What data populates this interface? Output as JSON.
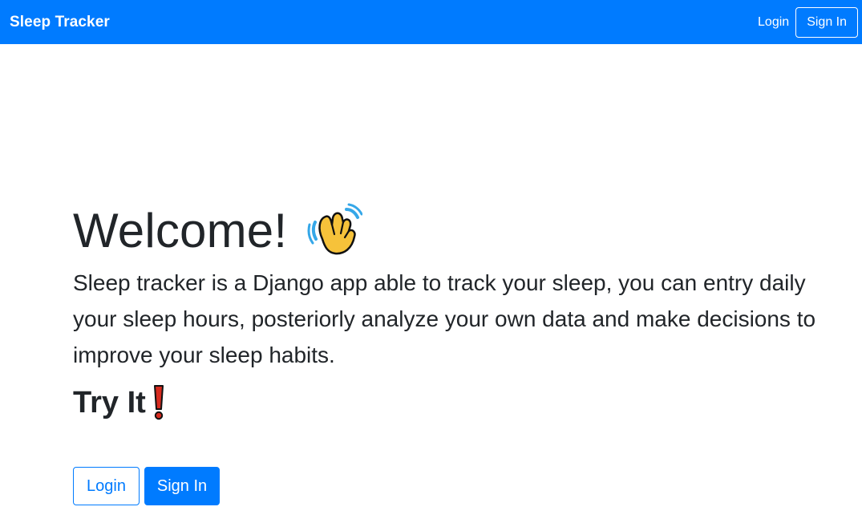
{
  "navbar": {
    "brand": "Sleep Tracker",
    "login_label": "Login",
    "signin_label": "Sign In"
  },
  "hero": {
    "title": "Welcome!",
    "title_icon": "waving-hand-icon",
    "description": "Sleep tracker is a Django app able to track your sleep, you can entry daily your sleep hours, posteriorly analyze your own data and make decisions to improve your sleep habits.",
    "subtitle": "Try It",
    "subtitle_icon": "exclamation-mark-icon"
  },
  "actions": {
    "login_label": "Login",
    "signin_label": "Sign In"
  },
  "colors": {
    "primary": "#007bff",
    "text": "#212529",
    "emoji_yellow": "#f6c23a",
    "emoji_red": "#d72b1f"
  }
}
